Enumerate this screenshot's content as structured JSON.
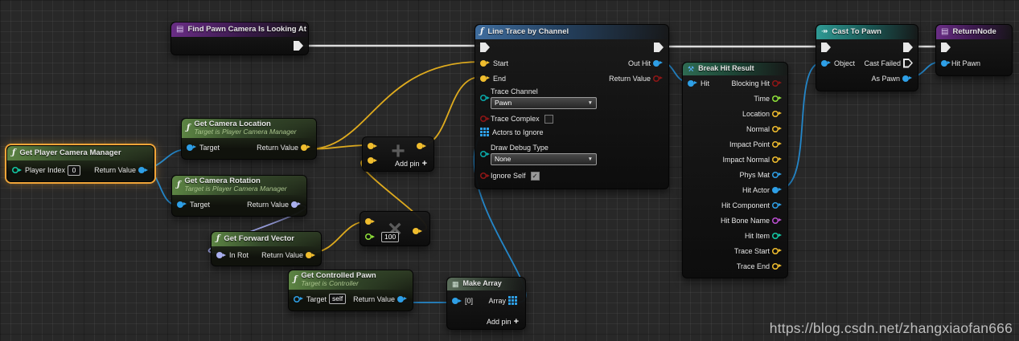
{
  "watermark": "https://blog.csdn.net/zhangxiaofan666",
  "icons": {
    "function": "ƒ",
    "event": "▤",
    "cast": "↠",
    "break": "⚒",
    "grid_header": "▦",
    "add_glyph": "+",
    "multiply_glyph": "×",
    "dropdown_arrow": "▼",
    "checkmark": "✓",
    "add_pin_plus": "+"
  },
  "colors": {
    "selection": "#f0a538",
    "exec_pin": "#e8e8e8",
    "vector_pin": "#f0bd2e",
    "object_pin": "#2e9fe6",
    "rotator_pin": "#aab0ee",
    "bool_pin": "#8e1616",
    "float_pin": "#8fe13a",
    "int_pin": "#13c9a5",
    "enum_pin": "#0aa8a8",
    "name_pin": "#bb4fd0",
    "wire_exec": "#dcdcdc",
    "wire_vector": "#dfab1e",
    "wire_object": "#2486c8",
    "wire_rotator": "#9aa0e0"
  },
  "nodes": {
    "find_pawn": {
      "title": "Find Pawn Camera Is Looking At"
    },
    "line_trace": {
      "title": "Line Trace by Channel",
      "pins": {
        "start": "Start",
        "end": "End",
        "trace_channel": "Trace Channel",
        "trace_channel_value": "Pawn",
        "trace_complex": "Trace Complex",
        "actors_to_ignore": "Actors to Ignore",
        "draw_debug_type": "Draw Debug Type",
        "draw_debug_value": "None",
        "ignore_self": "Ignore Self",
        "out_hit": "Out Hit",
        "return_value": "Return Value"
      },
      "states": {
        "trace_complex": "unchecked",
        "ignore_self": "checked"
      }
    },
    "cast_to_pawn": {
      "title": "Cast To Pawn",
      "pins": {
        "object": "Object",
        "cast_failed": "Cast Failed",
        "as_pawn": "As Pawn"
      }
    },
    "return_node": {
      "title": "ReturnNode",
      "pins": {
        "hit_pawn": "Hit Pawn"
      }
    },
    "break_hit_result": {
      "title": "Break Hit Result",
      "pins": {
        "hit": "Hit",
        "blocking_hit": "Blocking Hit",
        "time": "Time",
        "location": "Location",
        "normal": "Normal",
        "impact_point": "Impact Point",
        "impact_normal": "Impact Normal",
        "phys_mat": "Phys Mat",
        "hit_actor": "Hit Actor",
        "hit_component": "Hit Component",
        "hit_bone_name": "Hit Bone Name",
        "hit_item": "Hit Item",
        "trace_start": "Trace Start",
        "trace_end": "Trace End"
      }
    },
    "get_player_camera_manager": {
      "title": "Get Player Camera Manager",
      "pins": {
        "player_index": "Player Index",
        "player_index_value": "0",
        "return_value": "Return Value"
      },
      "selected": true
    },
    "get_camera_location": {
      "title": "Get Camera Location",
      "subtitle": "Target is Player Camera Manager",
      "pins": {
        "target": "Target",
        "return_value": "Return Value"
      }
    },
    "get_camera_rotation": {
      "title": "Get Camera Rotation",
      "subtitle": "Target is Player Camera Manager",
      "pins": {
        "target": "Target",
        "return_value": "Return Value"
      }
    },
    "get_forward_vector": {
      "title": "Get Forward Vector",
      "pins": {
        "in_rot": "In Rot",
        "return_value": "Return Value"
      }
    },
    "get_controlled_pawn": {
      "title": "Get Controlled Pawn",
      "subtitle": "Target is Controller",
      "pins": {
        "target": "Target",
        "target_value": "self",
        "return_value": "Return Value"
      }
    },
    "add": {
      "glyph": "+",
      "add_pin_label": "Add pin"
    },
    "multiply": {
      "glyph": "×",
      "b_value": "100"
    },
    "make_array": {
      "title": "Make Array",
      "pins": {
        "element0": "[0]",
        "array": "Array"
      },
      "add_pin_label": "Add pin"
    }
  },
  "connections": [
    {
      "from": "Find Pawn Camera Is Looking At.exec",
      "to": "Line Trace by Channel.exec"
    },
    {
      "from": "Line Trace by Channel.exec",
      "to": "Cast To Pawn.exec"
    },
    {
      "from": "Cast To Pawn.exec",
      "to": "ReturnNode.exec"
    },
    {
      "from": "Get Player Camera Manager.Return Value",
      "to": "Get Camera Location.Target"
    },
    {
      "from": "Get Player Camera Manager.Return Value",
      "to": "Get Camera Rotation.Target"
    },
    {
      "from": "Get Camera Location.Return Value",
      "to": "Line Trace by Channel.Start"
    },
    {
      "from": "Get Camera Location.Return Value",
      "to": "Add.A"
    },
    {
      "from": "Get Camera Rotation.Return Value",
      "to": "Get Forward Vector.In Rot"
    },
    {
      "from": "Get Forward Vector.Return Value",
      "to": "Multiply.A"
    },
    {
      "from": "Multiply.Result",
      "to": "Add.B"
    },
    {
      "from": "Add.Result",
      "to": "Line Trace by Channel.End"
    },
    {
      "from": "Get Controlled Pawn.Return Value",
      "to": "Make Array.[0]"
    },
    {
      "from": "Make Array.Array",
      "to": "Line Trace by Channel.Actors to Ignore"
    },
    {
      "from": "Line Trace by Channel.Out Hit",
      "to": "Break Hit Result.Hit"
    },
    {
      "from": "Break Hit Result.Hit Actor",
      "to": "Cast To Pawn.Object"
    },
    {
      "from": "Cast To Pawn.As Pawn",
      "to": "ReturnNode.Hit Pawn"
    }
  ]
}
